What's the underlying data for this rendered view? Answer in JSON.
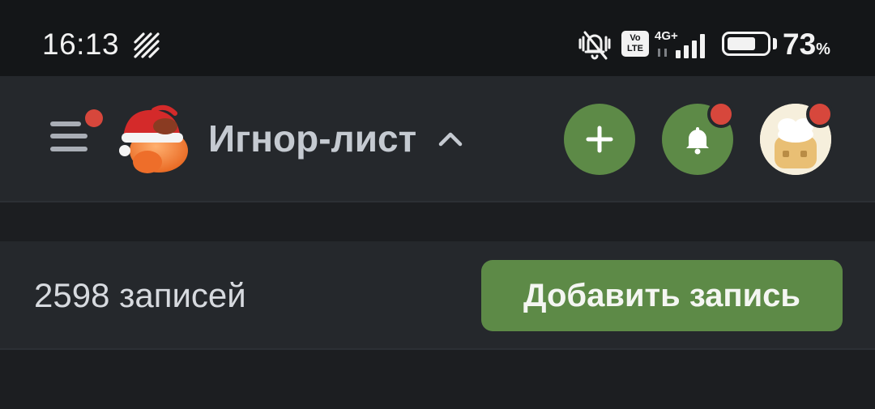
{
  "status_bar": {
    "time": "16:13",
    "network_type": "4G+",
    "volte_label_top": "Vo",
    "volte_label_bottom": "LTE",
    "battery_percent": "73",
    "battery_percent_sign": "%",
    "battery_level": 0.73,
    "icons": [
      "sync-icon",
      "mute-icon",
      "volte-icon",
      "signal-icon",
      "battery-icon"
    ]
  },
  "header": {
    "title": "Игнор-лист",
    "menu_has_notification": true,
    "bell_has_notification": true,
    "avatar_has_notification": true,
    "icons": [
      "menu-icon",
      "logo-santa-hat",
      "chevron-up-icon",
      "plus-icon",
      "bell-icon",
      "avatar"
    ]
  },
  "records": {
    "count_text": "2598 записей",
    "add_button_label": "Добавить запись"
  },
  "colors": {
    "accent_green": "#5d8a47",
    "notification_red": "#d7473c",
    "header_bg": "#25282c",
    "page_bg": "#1c1e21",
    "status_bg": "#141618",
    "logo_orange": "#f07a2a"
  }
}
